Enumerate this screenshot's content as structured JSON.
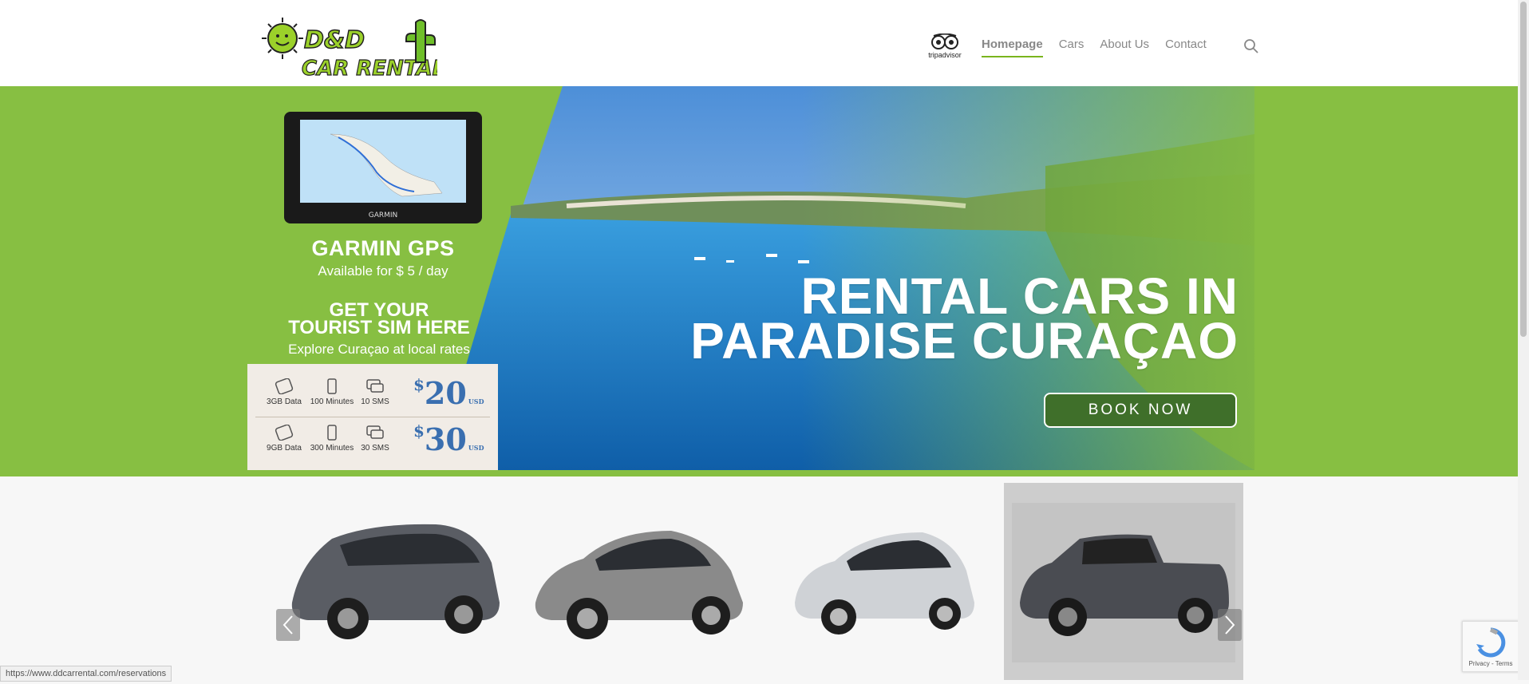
{
  "brand": {
    "logo_line1": "D&D",
    "logo_line2": "CAR RENTAL"
  },
  "nav": {
    "tripadvisor": "tripadvisor",
    "items": [
      {
        "label": "Homepage",
        "active": true
      },
      {
        "label": "Cars"
      },
      {
        "label": "About Us"
      },
      {
        "label": "Contact"
      }
    ],
    "search_icon": "search-icon"
  },
  "promo": {
    "gps_brand": "GARMIN",
    "gps_title": "GARMIN GPS",
    "gps_sub": "Available for $ 5 / day",
    "sim_title_1": "GET YOUR",
    "sim_title_2": "TOURIST SIM HERE",
    "sim_sub": "Explore Curaçao at local rates",
    "plans": [
      {
        "data": "3GB Data",
        "minutes": "100 Minutes",
        "sms": "10 SMS",
        "currency": "$",
        "price": "20",
        "unit": "USD"
      },
      {
        "data": "9GB Data",
        "minutes": "300 Minutes",
        "sms": "30 SMS",
        "currency": "$",
        "price": "30",
        "unit": "USD"
      }
    ]
  },
  "hero": {
    "headline_1": "RENTAL CARS IN",
    "headline_2": "PARADISE CURAÇAO",
    "book_label": "BOOK NOW"
  },
  "status_url": "https://www.ddcarrental.com/reservations",
  "recaptcha": {
    "terms": "Privacy - Terms"
  },
  "colors": {
    "accent": "#7ab51d",
    "hero_green": "#87bf42",
    "book_bg": "#3f6f2a"
  }
}
